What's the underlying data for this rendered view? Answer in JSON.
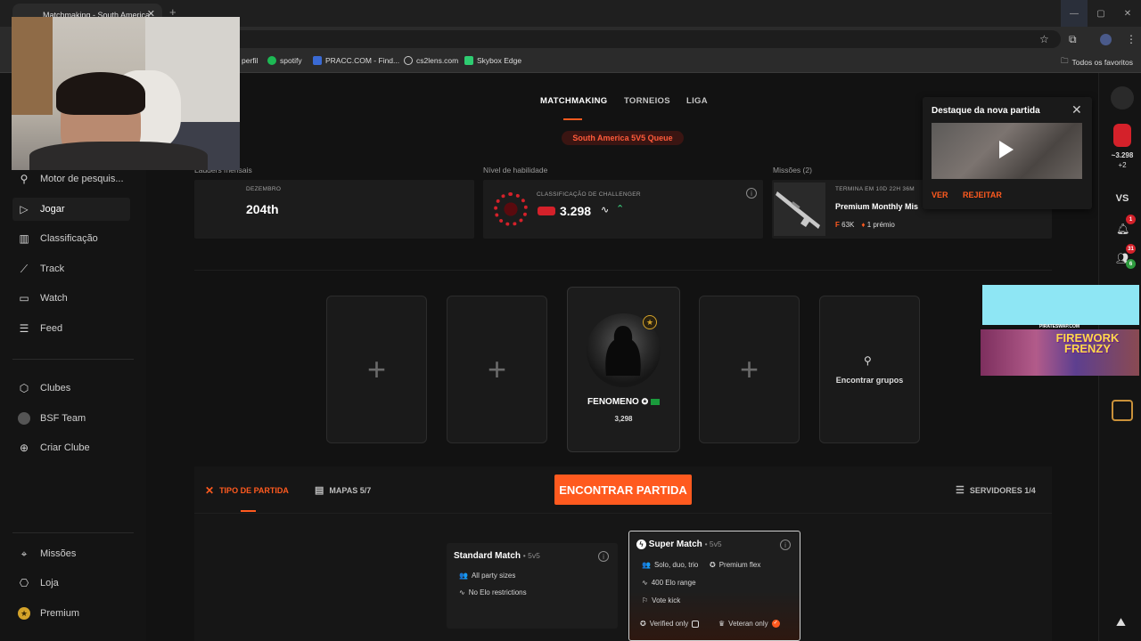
{
  "browser": {
    "tab_title": "Matchmaking - South America",
    "new_tab": "+",
    "close_tab": "✕",
    "window": {
      "min": "—",
      "max": "▢",
      "close": "✕"
    },
    "bookmarks": [
      {
        "label": "perfil"
      },
      {
        "label": "spotify"
      },
      {
        "label": "PRACC.COM - Find..."
      },
      {
        "label": "cs2lens.com"
      },
      {
        "label": "Skybox Edge"
      }
    ],
    "all_favorites": "Todos os favoritos"
  },
  "sidebar": {
    "items": [
      {
        "label": "Motor de pesquis...",
        "icon": "search-people-icon"
      },
      {
        "label": "Jogar",
        "icon": "play-icon",
        "active": true
      },
      {
        "label": "Classificação",
        "icon": "bar-chart-icon"
      },
      {
        "label": "Track",
        "icon": "trend-icon"
      },
      {
        "label": "Watch",
        "icon": "tv-icon"
      },
      {
        "label": "Feed",
        "icon": "feed-icon"
      },
      {
        "label": "Clubes",
        "icon": "clubs-icon"
      },
      {
        "label": "BSF Team",
        "icon": "team-avatar-icon"
      },
      {
        "label": "Criar Clube",
        "icon": "plus-circle-icon"
      },
      {
        "label": "Missões",
        "icon": "missions-icon"
      },
      {
        "label": "Loja",
        "icon": "shop-icon"
      },
      {
        "label": "Premium",
        "icon": "premium-star-icon"
      }
    ]
  },
  "header": {
    "tabs": [
      {
        "label": "MATCHMAKING"
      },
      {
        "label": "TORNEIOS"
      },
      {
        "label": "LIGA"
      }
    ],
    "queue": "South America 5V5 Queue"
  },
  "stats": {
    "ladder_label": "Ladders mensais",
    "month": "DEZEMBRO",
    "rank": "204th",
    "skill_label": "Nível de habilidade",
    "skill_sub": "CLASSIFICAÇÃO DE CHALLENGER",
    "elo": "3.298",
    "missions_label": "Missões (2)",
    "mission_ends": "TERMINA EM 10D 22H 36M",
    "mission_title": "Premium Monthly Mis",
    "mission_points": "63K",
    "mission_reward": "1 prémio"
  },
  "party": {
    "empty_slot": "+",
    "player_name": "FENOMENO",
    "player_elo": "3,298",
    "find_groups": "Encontrar grupos"
  },
  "match": {
    "tipo": "TIPO DE PARTIDA",
    "mapas": "MAPAS 5/7",
    "find_match": "ENCONTRAR PARTIDA",
    "servers": "SERVIDORES 1/4",
    "standard": {
      "title": "Standard Match",
      "sub": "• 5v5",
      "features": [
        "All party sizes",
        "No Elo restrictions"
      ]
    },
    "super": {
      "title": "Super Match",
      "sub": "• 5v5",
      "features": [
        "Solo, duo, trio",
        "Premium flex",
        "400 Elo range",
        "Vote kick"
      ],
      "verified": "Verified only",
      "veteran": "Veteran only"
    }
  },
  "highlight": {
    "title": "Destaque da nova partida",
    "ver": "VER",
    "rejeitar": "REJEITAR"
  },
  "rail": {
    "elo": "~3.298",
    "elo_delta": "+2",
    "vs": "VS",
    "notif_count": "1",
    "friends_count": "31",
    "online_count": "6"
  },
  "ad": {
    "brand": "PIRATESWAP.COM",
    "title": "FIREWORK FRENZY"
  }
}
